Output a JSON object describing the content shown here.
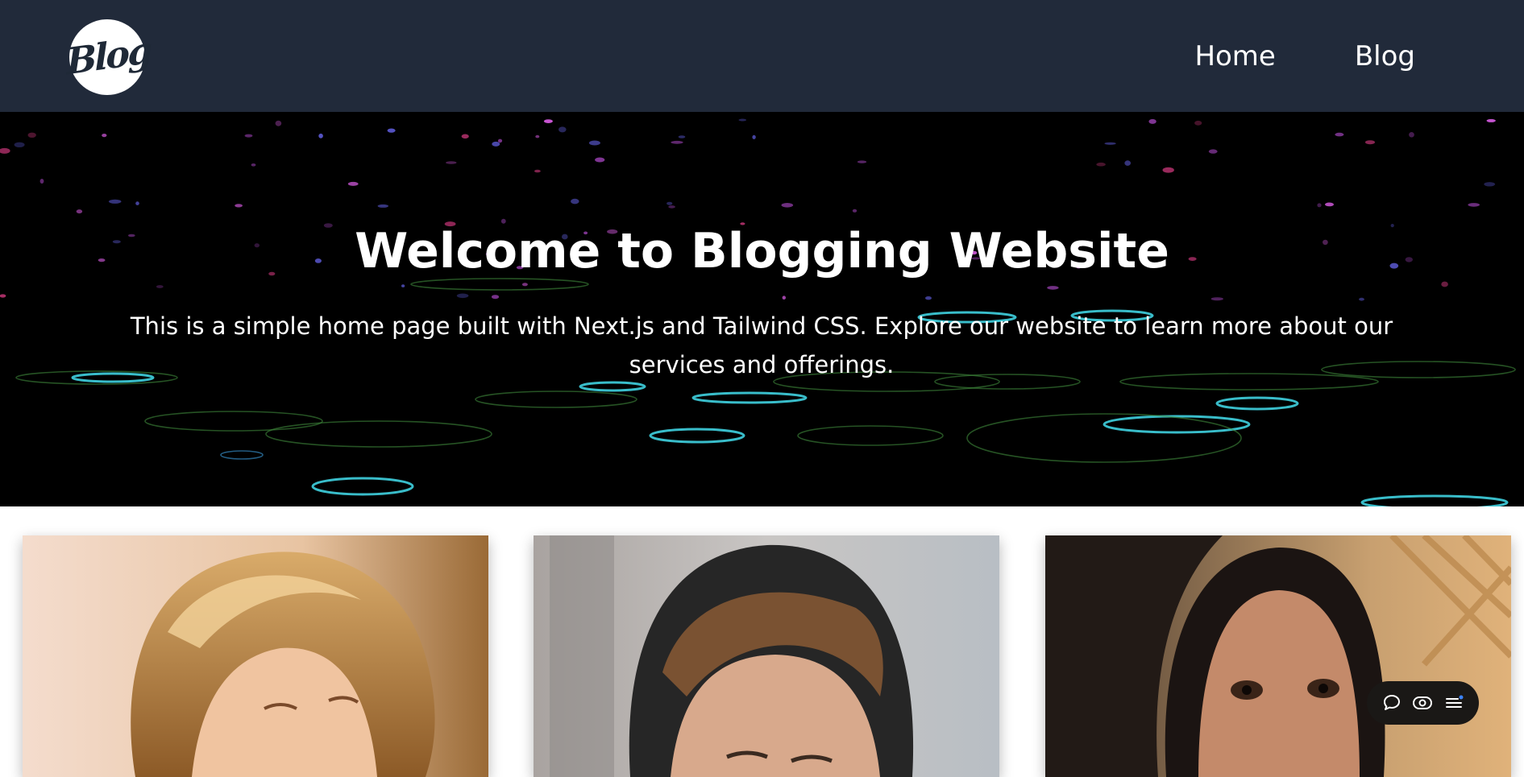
{
  "header": {
    "logo_text": "Blog",
    "nav": [
      {
        "label": "Home"
      },
      {
        "label": "Blog"
      }
    ]
  },
  "hero": {
    "title": "Welcome to Blogging Website",
    "subtitle": "This is a simple home page built with Next.js and Tailwind CSS. Explore our website to learn more about our services and offerings."
  },
  "cards": [
    {
      "image": "blonde-woman-photo"
    },
    {
      "image": "man-in-beanie-photo"
    },
    {
      "image": "girl-portrait-photo"
    }
  ],
  "toolbar": {
    "icons": [
      "chat-bubble-icon",
      "eye-toggle-icon",
      "menu-list-icon"
    ]
  },
  "colors": {
    "header_bg": "#212a3a",
    "hero_bg": "#000000",
    "text": "#ffffff",
    "ring_cyan": "#3fd2e0",
    "ring_green": "#3f8a3c",
    "dot_pink": "#d45adf"
  }
}
